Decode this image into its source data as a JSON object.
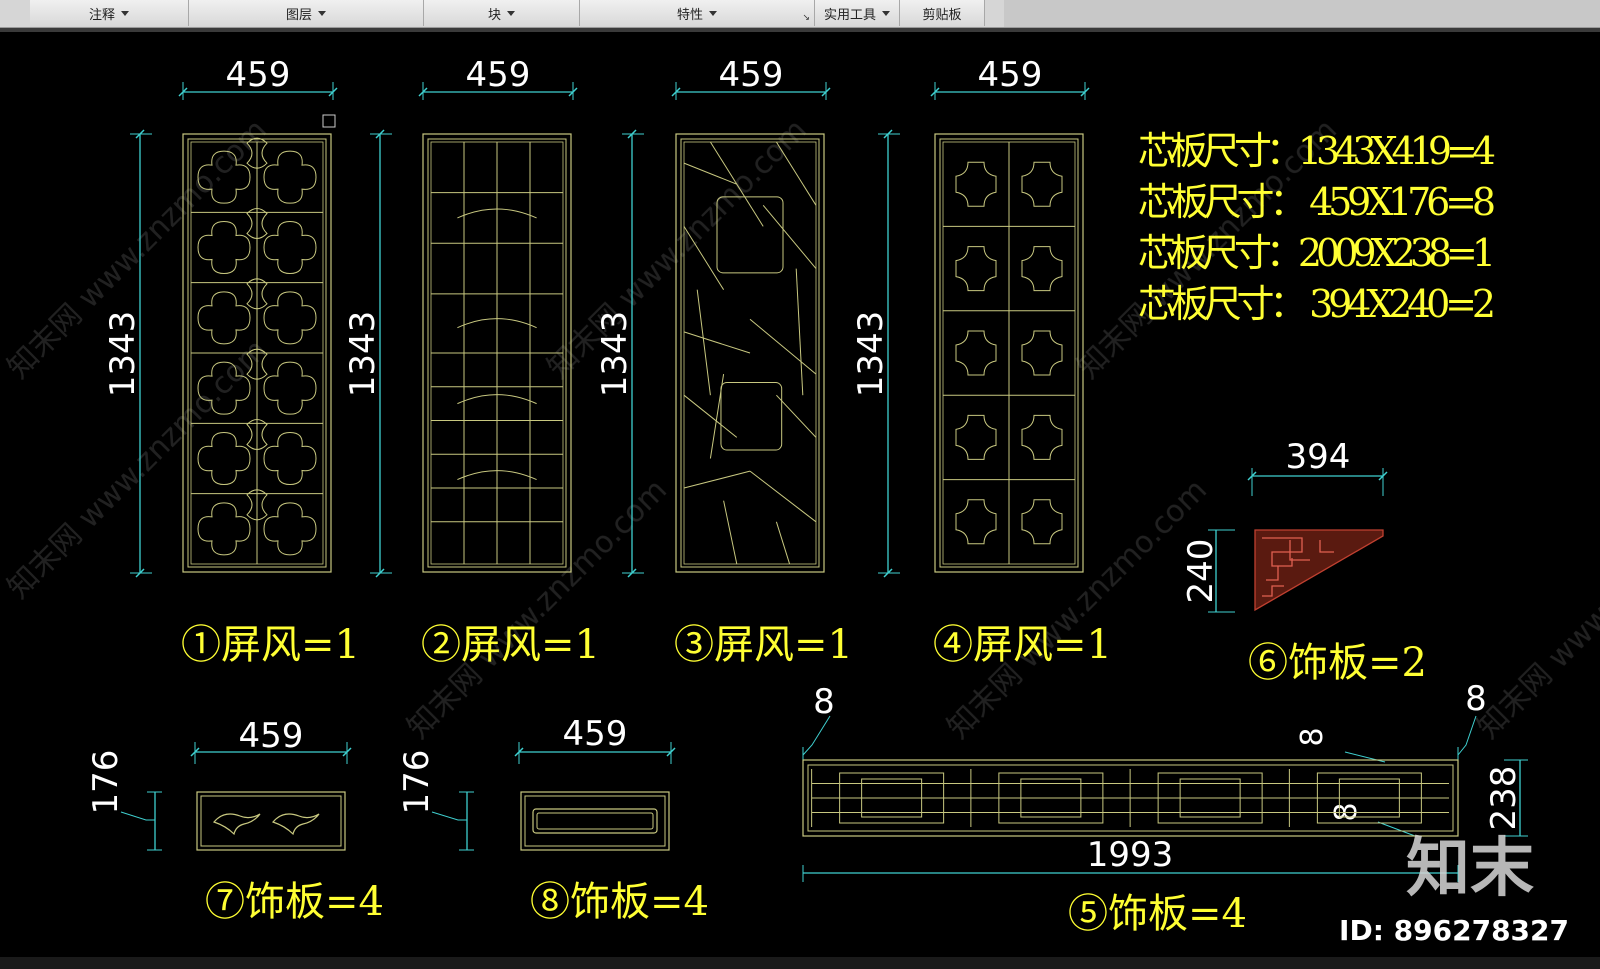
{
  "ribbon": {
    "panels": [
      {
        "label": "注释",
        "dropdown": true
      },
      {
        "label": "图层",
        "dropdown": true
      },
      {
        "label": "块",
        "dropdown": true
      },
      {
        "label": "特性",
        "dropdown": true,
        "launcher": "↘"
      },
      {
        "label": "实用工具",
        "dropdown": true
      },
      {
        "label": "剪贴板",
        "dropdown": false
      }
    ]
  },
  "colors": {
    "background": "#000000",
    "dimension": "#3fd0d0",
    "linework": "#c8c880",
    "text": "#ffff33",
    "dim_text": "#ffffff",
    "bracket": "#a03020"
  },
  "screens": [
    {
      "width": "459",
      "height": "1343",
      "label": "①屏风=1",
      "pattern": "floral-lattice"
    },
    {
      "width": "459",
      "height": "1343",
      "label": "②屏风=1",
      "pattern": "grid-lattice"
    },
    {
      "width": "459",
      "height": "1343",
      "label": "③屏风=1",
      "pattern": "ice-crack"
    },
    {
      "width": "459",
      "height": "1343",
      "label": "④屏风=1",
      "pattern": "quatrefoil-grid"
    }
  ],
  "notes": [
    "芯板尺寸：1343X419=4",
    "芯板尺寸： 459X176=8",
    "芯板尺寸：2009X238=1",
    "芯板尺寸： 394X240=2"
  ],
  "bracket": {
    "width": "394",
    "height": "240",
    "label": "⑥饰板=2"
  },
  "panel7": {
    "width": "459",
    "height": "176",
    "label": "⑦饰板=4"
  },
  "panel8": {
    "width": "459",
    "height": "176",
    "label": "⑧饰板=4"
  },
  "panel5": {
    "width": "1993",
    "height": "238",
    "inset_left": "8",
    "inset_right": "8",
    "inset_a": "8",
    "inset_b": "8",
    "label": "⑤饰板=4"
  },
  "watermark": {
    "logo": "知末",
    "id": "ID: 896278327",
    "text": "知末网 www.znzmo.com"
  }
}
